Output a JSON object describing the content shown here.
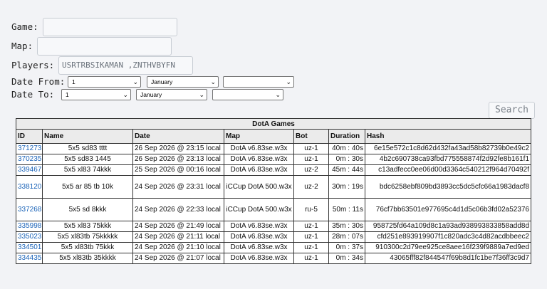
{
  "form": {
    "game_label": "Game:",
    "map_label": "Map:",
    "players_label": "Players:",
    "players_value": "USRTRBSIKAMAN ,ZNTHVBYFN",
    "date_from_label": "Date From:",
    "date_to_label": "Date To:",
    "from_day": "1",
    "from_month": "January",
    "from_year": "",
    "to_day": "1",
    "to_month": "January",
    "to_year": "",
    "search_label": "Search"
  },
  "table": {
    "caption": "DotA Games",
    "headers": [
      "ID",
      "Name",
      "Date",
      "Map",
      "Bot",
      "Duration",
      "Hash"
    ],
    "rows": [
      {
        "id": "371273",
        "name": "5x5 sd83 tttt",
        "date": "26 Sep 2026 @ 23:15 local",
        "map": "DotA v6.83se.w3x",
        "bot": "uz-1",
        "duration": "40m : 40s",
        "hash": "6e15e572c1c8d62d432fa43ad58b82739b0e49c2"
      },
      {
        "id": "370235",
        "name": "5x5 sd83 1445",
        "date": "26 Sep 2026 @ 23:13 local",
        "map": "DotA v6.83se.w3x",
        "bot": "uz-1",
        "duration": "0m : 30s",
        "hash": "4b2c690738ca93fbd775558874f2d92fe8b161f1"
      },
      {
        "id": "339467",
        "name": "5x5 xl83 74kkk",
        "date": "25 Sep 2026 @ 00:16 local",
        "map": "DotA v6.83se.w3x",
        "bot": "uz-2",
        "duration": "45m : 44s",
        "hash": "c13adfecc0ee06d00d3364c540212f964d70492f"
      },
      {
        "id": "338120",
        "name": "5x5 ar 85 tb 10k",
        "date": "24 Sep 2026 @ 23:31 local",
        "map": "iCCup DotA 500.w3x",
        "bot": "uz-2",
        "duration": "30m : 19s",
        "hash": "bdc6258ebf809bd3893cc5dc5cfc66a1983dacf8"
      },
      {
        "id": "337268",
        "name": "5x5 sd 8kkk",
        "date": "24 Sep 2026 @ 22:33 local",
        "map": "iCCup DotA 500.w3x",
        "bot": "ru-5",
        "duration": "50m : 11s",
        "hash": "76cf7bb63501e977695c4d1d5c06b3fd02a52376"
      },
      {
        "id": "335998",
        "name": "5x5 xl83 75kkk",
        "date": "24 Sep 2026 @ 21:49 local",
        "map": "DotA v6.83se.w3x",
        "bot": "uz-1",
        "duration": "35m : 30s",
        "hash": "958725fd64a109d8c1a93ad938993833858add8d"
      },
      {
        "id": "335023",
        "name": "5x5 xl83tb 75kkkkk",
        "date": "24 Sep 2026 @ 21:11 local",
        "map": "DotA v6.83se.w3x",
        "bot": "uz-1",
        "duration": "28m : 07s",
        "hash": "cfd251e893919907f1c820adc3c4d82acdbbeec2"
      },
      {
        "id": "334501",
        "name": "5x5 xl83tb 75kkk",
        "date": "24 Sep 2026 @ 21:10 local",
        "map": "DotA v6.83se.w3x",
        "bot": "uz-1",
        "duration": "0m : 37s",
        "hash": "910300c2d79ee925ce8aee16f239f9889a7ed9ed"
      },
      {
        "id": "334435",
        "name": "5x5 xl83tb 35kkkk",
        "date": "24 Sep 2026 @ 21:07 local",
        "map": "DotA v6.83se.w3x",
        "bot": "uz-1",
        "duration": "0m : 34s",
        "hash": "43065fff82f844547f69b8d1fc1be7f36ff3c9d7"
      }
    ]
  }
}
